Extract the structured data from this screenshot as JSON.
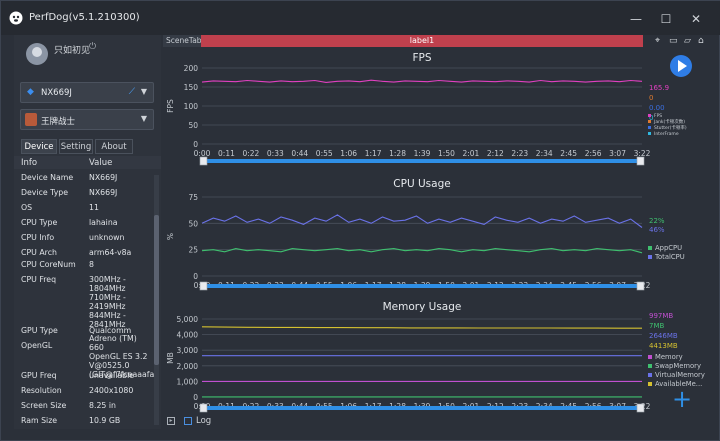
{
  "window": {
    "title": "PerfDog(v5.1.210300)",
    "controls": [
      "minimize",
      "maximize",
      "close"
    ]
  },
  "sidebar": {
    "user_name": "只如初见",
    "device_select": "NX669J",
    "app_select": "王牌战士",
    "tabs": [
      "Device",
      "Setting",
      "About"
    ],
    "active_tab": "Device",
    "table_headers": [
      "Info",
      "Value"
    ],
    "rows": [
      {
        "key": "Device Name",
        "value": "NX669J"
      },
      {
        "key": "Device Type",
        "value": "NX669J"
      },
      {
        "key": "OS",
        "value": "11"
      },
      {
        "key": "CPU Type",
        "value": "lahaina"
      },
      {
        "key": "CPU Info",
        "value": "unknown"
      },
      {
        "key": "CPU Arch",
        "value": "arm64-v8a"
      },
      {
        "key": "CPU CoreNum",
        "value": "8"
      },
      {
        "key": "CPU Freq",
        "value": "300MHz -\n1804MHz\n710MHz -\n2419MHz\n844MHz -\n2841MHz"
      },
      {
        "key": "GPU Type",
        "value": "Qualcomm"
      },
      {
        "key": "OpenGL",
        "value": "Adreno (TM) 660\nOpenGL ES 3.2\nV@0525.0\n(GIT@f7fceaaafa"
      },
      {
        "key": "GPU Freq",
        "value": "unavailable"
      },
      {
        "key": "Resolution",
        "value": "2400x1080"
      },
      {
        "key": "Screen Size",
        "value": "8.25 in"
      },
      {
        "key": "Ram Size",
        "value": "10.9 GB"
      }
    ]
  },
  "main": {
    "scene_tab": "SceneTab",
    "label_tab": "label1",
    "log_label": "Log",
    "x_ticks": [
      "0:00",
      "0:11",
      "0:22",
      "0:33",
      "0:44",
      "0:55",
      "1:06",
      "1:17",
      "1:28",
      "1:39",
      "1:50",
      "2:01",
      "2:12",
      "2:23",
      "2:34",
      "2:45",
      "2:56",
      "3:07",
      "3:22"
    ],
    "colors": {
      "fps": "#e040c0",
      "app_cpu": "#3fbf6f",
      "total_cpu": "#6a72e8",
      "memory": "#d4c030",
      "accent": "#2f8fe6",
      "label_tab": "#c0404d"
    }
  },
  "chart_data": [
    {
      "type": "line",
      "title": "FPS",
      "ylabel": "FPS",
      "ylim": [
        0,
        200
      ],
      "y_ticks": [
        "0",
        "50",
        "100",
        "150",
        "200"
      ],
      "series": [
        {
          "name": "FPS",
          "values": [
            163,
            166,
            165,
            164,
            167,
            165,
            163,
            166,
            164,
            165,
            167,
            162,
            165,
            166,
            164,
            168,
            165,
            163,
            166,
            165,
            164,
            167,
            165,
            163,
            166,
            165,
            164,
            166,
            165,
            163,
            167,
            164,
            166,
            165,
            163,
            165,
            166,
            164,
            167,
            165
          ]
        }
      ],
      "legend": [
        {
          "name": "FPS",
          "value": "165.9",
          "color": "#e040c0"
        },
        {
          "name": "Jank(卡顿次数)",
          "value": "0",
          "color": "#e07a30"
        },
        {
          "name": "Stutter(卡顿率)",
          "value": "0.00",
          "color": "#3a6ee0"
        },
        {
          "name": "InterFrame",
          "value": "0",
          "color": "#30b8e0"
        }
      ]
    },
    {
      "type": "line",
      "title": "CPU Usage",
      "ylabel": "%",
      "ylim": [
        0,
        75
      ],
      "y_ticks": [
        "0",
        "25",
        "50",
        "75"
      ],
      "series": [
        {
          "name": "AppCPU",
          "values": [
            24,
            25,
            23,
            26,
            24,
            25,
            24,
            23,
            26,
            25,
            24,
            25,
            26,
            24,
            25,
            23,
            25,
            26,
            24,
            25,
            24,
            26,
            25,
            23,
            25,
            24,
            26,
            25,
            24,
            23,
            25,
            26,
            24,
            25,
            24,
            26,
            25,
            24,
            25,
            22
          ]
        },
        {
          "name": "TotalCPU",
          "values": [
            50,
            55,
            52,
            57,
            51,
            54,
            50,
            56,
            53,
            49,
            55,
            52,
            58,
            51,
            54,
            50,
            56,
            52,
            53,
            57,
            50,
            54,
            51,
            55,
            52,
            49,
            56,
            53,
            51,
            55,
            50,
            54,
            52,
            57,
            51,
            53,
            55,
            50,
            54,
            46
          ]
        }
      ],
      "legend": [
        {
          "name": "AppCPU",
          "value": "22%",
          "color": "#3fbf6f"
        },
        {
          "name": "TotalCPU",
          "value": "46%",
          "color": "#6a72e8"
        }
      ]
    },
    {
      "type": "line",
      "title": "Memory Usage",
      "ylabel": "MB",
      "ylim": [
        0,
        5000
      ],
      "y_ticks": [
        "0",
        "1,000",
        "2,000",
        "3,000",
        "4,000",
        "5,000"
      ],
      "series": [
        {
          "name": "Memory",
          "values": [
            997,
            997,
            997,
            997,
            997,
            997,
            997,
            997,
            997,
            997,
            997,
            997,
            997,
            997,
            997,
            997,
            997,
            997,
            997,
            997
          ]
        },
        {
          "name": "SwapMemory",
          "values": [
            7,
            7,
            7,
            7,
            7,
            7,
            7,
            7,
            7,
            7,
            7,
            7,
            7,
            7,
            7,
            7,
            7,
            7,
            7,
            7
          ]
        },
        {
          "name": "VirtualMemory",
          "values": [
            2646,
            2646,
            2646,
            2646,
            2646,
            2646,
            2646,
            2646,
            2646,
            2646,
            2646,
            2646,
            2646,
            2646,
            2646,
            2646,
            2646,
            2646,
            2646,
            2646
          ]
        },
        {
          "name": "AvailableMe...",
          "values": [
            4500,
            4480,
            4470,
            4460,
            4460,
            4450,
            4450,
            4440,
            4440,
            4430,
            4430,
            4430,
            4420,
            4420,
            4420,
            4420,
            4415,
            4415,
            4413,
            4413
          ]
        }
      ],
      "legend": [
        {
          "name": "Memory",
          "value": "997MB",
          "color": "#c050d0"
        },
        {
          "name": "SwapMemory",
          "value": "7MB",
          "color": "#3fbf6f"
        },
        {
          "name": "VirtualMemory",
          "value": "2646MB",
          "color": "#6a72e8"
        },
        {
          "name": "AvailableMe...",
          "value": "4413MB",
          "color": "#d4c030"
        }
      ]
    }
  ]
}
